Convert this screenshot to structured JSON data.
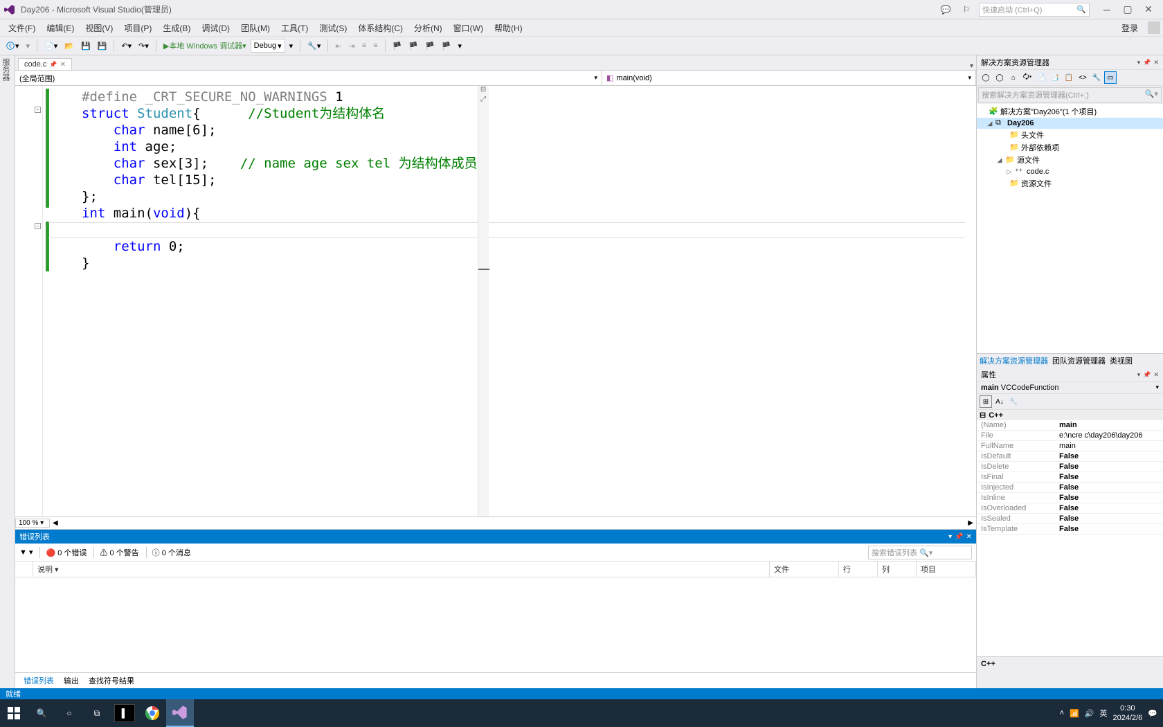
{
  "titlebar": {
    "title": "Day206 - Microsoft Visual Studio(管理员)",
    "search_placeholder": "快速启动 (Ctrl+Q)"
  },
  "menus": [
    "文件(F)",
    "编辑(E)",
    "视图(V)",
    "项目(P)",
    "生成(B)",
    "调试(D)",
    "团队(M)",
    "工具(T)",
    "测试(S)",
    "体系结构(C)",
    "分析(N)",
    "窗口(W)",
    "帮助(H)"
  ],
  "login": "登录",
  "toolbar": {
    "debug_target": "本地 Windows 调试器",
    "config": "Debug"
  },
  "left_tab": "服务器",
  "editor": {
    "tab": "code.c",
    "scope": "(全局范围)",
    "member": "main(void)",
    "zoom": "100 %",
    "lines": [
      {
        "html": "<span class='pp'>#define</span> <span class='pp'>_CRT_SECURE_NO_WARNINGS</span> 1"
      },
      {
        "html": "<span class='kw'>struct</span> <span class='type'>Student</span>{      <span class='comment'>//Student为结构体名</span>"
      },
      {
        "html": "    <span class='kw'>char</span> name[6];"
      },
      {
        "html": "    <span class='kw'>int</span> age;"
      },
      {
        "html": "    <span class='kw'>char</span> sex[3];    <span class='comment'>// name age sex tel 为结构体成员</span>"
      },
      {
        "html": "    <span class='kw'>char</span> tel[15];"
      },
      {
        "html": "};"
      },
      {
        "html": "<span class='kw'>int</span> main(<span class='kw'>void</span>){"
      },
      {
        "html": " "
      },
      {
        "html": "    <span class='kw'>return</span> 0;"
      },
      {
        "html": "}"
      }
    ]
  },
  "errorlist": {
    "title": "错误列表",
    "errors": "0 个错误",
    "warnings": "0 个警告",
    "messages": "0 个消息",
    "search": "搜索错误列表",
    "cols": [
      "",
      "说明",
      "文件",
      "行",
      "列",
      "项目"
    ],
    "tabs": [
      "错误列表",
      "输出",
      "查找符号结果"
    ]
  },
  "solution": {
    "title": "解决方案资源管理器",
    "search": "搜索解决方案资源管理器(Ctrl+;)",
    "root": "解决方案\"Day206\"(1 个项目)",
    "project": "Day206",
    "folders": {
      "header": "头文件",
      "extern": "外部依赖项",
      "source": "源文件",
      "resource": "资源文件"
    },
    "file": "code.c",
    "tabs": [
      "解决方案资源管理器",
      "团队资源管理器",
      "类视图"
    ]
  },
  "properties": {
    "title": "属性",
    "object": "main",
    "type": "VCCodeFunction",
    "category": "C++",
    "rows": [
      {
        "name": "(Name)",
        "val": "main",
        "bold": true
      },
      {
        "name": "File",
        "val": "e:\\ncre c\\day206\\day206"
      },
      {
        "name": "FullName",
        "val": "main"
      },
      {
        "name": "IsDefault",
        "val": "False",
        "bold": true
      },
      {
        "name": "IsDelete",
        "val": "False",
        "bold": true
      },
      {
        "name": "IsFinal",
        "val": "False",
        "bold": true
      },
      {
        "name": "IsInjected",
        "val": "False",
        "bold": true
      },
      {
        "name": "IsInline",
        "val": "False",
        "bold": true
      },
      {
        "name": "IsOverloaded",
        "val": "False",
        "bold": true
      },
      {
        "name": "IsSealed",
        "val": "False",
        "bold": true
      },
      {
        "name": "IsTemplate",
        "val": "False",
        "bold": true
      }
    ],
    "desc": "C++"
  },
  "statusbar": "就绪",
  "taskbar": {
    "ime": "英",
    "time": "0:30",
    "date": "2024/2/6"
  }
}
